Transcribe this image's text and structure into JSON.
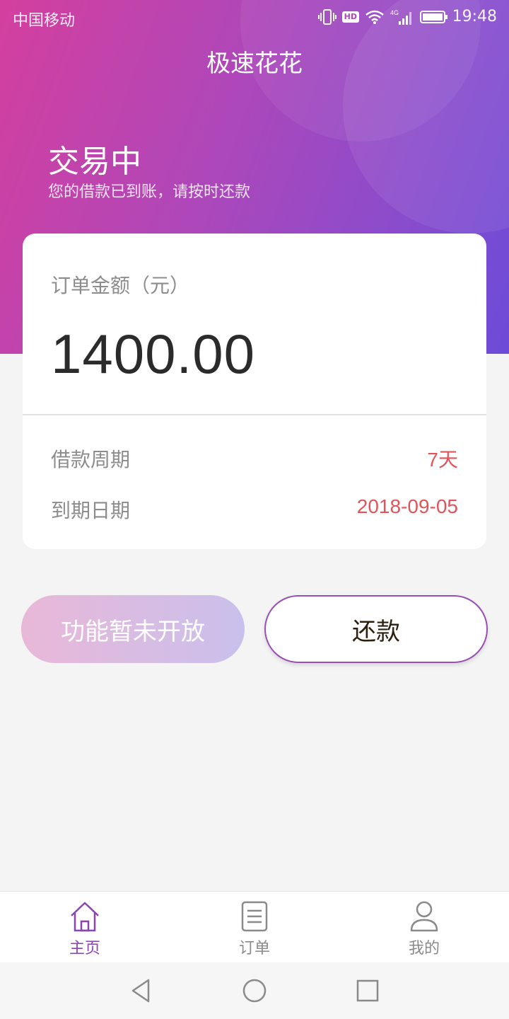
{
  "statusbar": {
    "carrier": "中国移动",
    "hd": "HD",
    "network": "4G",
    "time": "19:48"
  },
  "header": {
    "title": "极速花花"
  },
  "status": {
    "heading": "交易中",
    "subtitle": "您的借款已到账，请按时还款"
  },
  "order": {
    "amount_label": "订单金额（元）",
    "amount": "1400.00",
    "rows": [
      {
        "label": "借款周期",
        "value": "7天"
      },
      {
        "label": "到期日期",
        "value": "2018-09-05"
      }
    ]
  },
  "actions": {
    "disabled_label": "功能暂未开放",
    "repay_label": "还款"
  },
  "tabs": [
    {
      "label": "主页",
      "icon": "home-icon",
      "active": true
    },
    {
      "label": "订单",
      "icon": "document-icon",
      "active": false
    },
    {
      "label": "我的",
      "icon": "user-icon",
      "active": false
    }
  ],
  "colors": {
    "accent": "#8a46b0",
    "highlight": "#e0545a",
    "gradient_start": "#d43f9e",
    "gradient_end": "#6c4bd8"
  }
}
